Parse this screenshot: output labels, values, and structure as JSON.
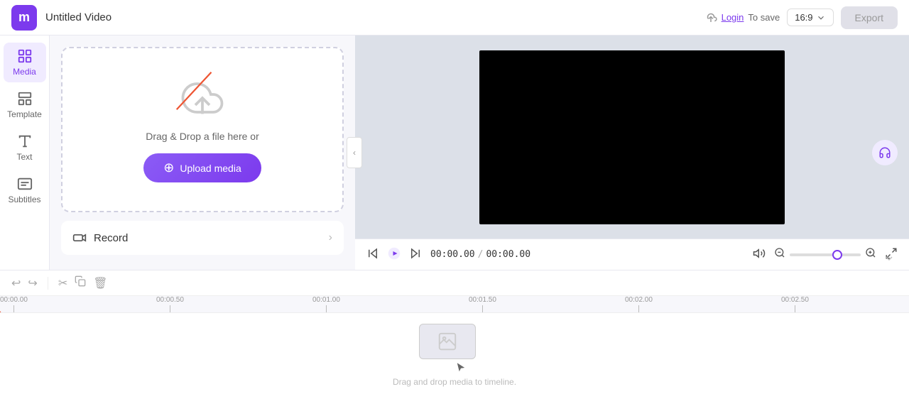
{
  "topbar": {
    "logo": "m",
    "title": "Untitled Video",
    "login_label": "Login",
    "login_hint": "To save",
    "ratio": "16:9",
    "export_label": "Export"
  },
  "sidebar": {
    "items": [
      {
        "id": "media",
        "label": "Media",
        "icon": "media-icon",
        "active": true
      },
      {
        "id": "template",
        "label": "Template",
        "icon": "template-icon",
        "active": false
      },
      {
        "id": "text",
        "label": "Text",
        "icon": "text-icon",
        "active": false
      },
      {
        "id": "subtitles",
        "label": "Subtitles",
        "icon": "subtitles-icon",
        "active": false
      }
    ]
  },
  "panel": {
    "drag_text": "Drag & Drop a file here or",
    "upload_label": "Upload media",
    "record_label": "Record"
  },
  "playback": {
    "current_time": "00:00.00",
    "total_time": "00:00.00"
  },
  "timeline": {
    "ruler_marks": [
      {
        "label": "00:00.00",
        "pos": 0
      },
      {
        "label": "00:00.50",
        "pos": 220
      },
      {
        "label": "00:01.00",
        "pos": 440
      },
      {
        "label": "00:01.50",
        "pos": 660
      },
      {
        "label": "00:02.00",
        "pos": 880
      },
      {
        "label": "00:02.50",
        "pos": 1100
      }
    ],
    "drop_hint": "Drag and drop media to timeline."
  }
}
